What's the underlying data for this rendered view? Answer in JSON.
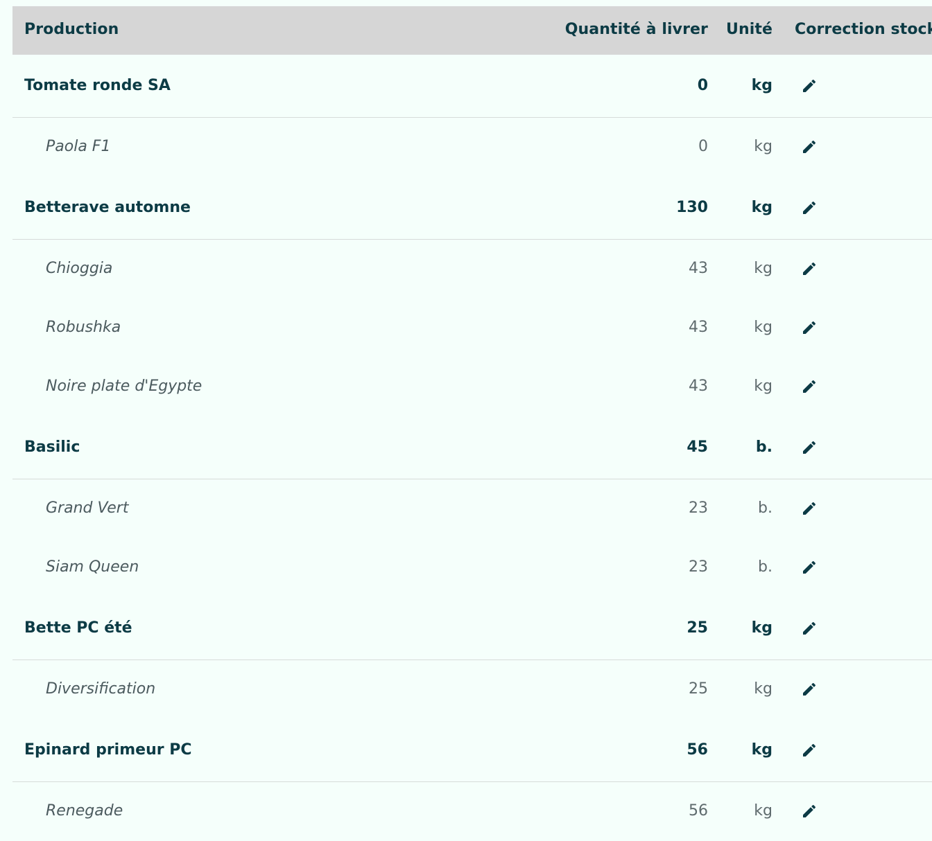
{
  "columns": {
    "production": "Production",
    "quantity": "Quantité à livrer",
    "unit": "Unité",
    "correction": "Correction stock"
  },
  "rows": [
    {
      "type": "group",
      "name": "Tomate ronde SA",
      "quantity": "0",
      "unit": "kg"
    },
    {
      "type": "sub",
      "name": "Paola F1",
      "quantity": "0",
      "unit": "kg"
    },
    {
      "type": "group",
      "name": "Betterave automne",
      "quantity": "130",
      "unit": "kg"
    },
    {
      "type": "sub",
      "name": "Chioggia",
      "quantity": "43",
      "unit": "kg"
    },
    {
      "type": "sub",
      "name": "Robushka",
      "quantity": "43",
      "unit": "kg"
    },
    {
      "type": "sub",
      "name": "Noire plate d'Egypte",
      "quantity": "43",
      "unit": "kg"
    },
    {
      "type": "group",
      "name": "Basilic",
      "quantity": "45",
      "unit": "b."
    },
    {
      "type": "sub",
      "name": "Grand Vert",
      "quantity": "23",
      "unit": "b."
    },
    {
      "type": "sub",
      "name": "Siam Queen",
      "quantity": "23",
      "unit": "b."
    },
    {
      "type": "group",
      "name": "Bette PC été",
      "quantity": "25",
      "unit": "kg"
    },
    {
      "type": "sub",
      "name": "Diversification",
      "quantity": "25",
      "unit": "kg"
    },
    {
      "type": "group",
      "name": "Epinard primeur PC",
      "quantity": "56",
      "unit": "kg"
    },
    {
      "type": "sub",
      "name": "Renegade",
      "quantity": "56",
      "unit": "kg"
    }
  ],
  "icons": {
    "edit": "pencil-icon"
  },
  "colors": {
    "header_bg": "#d6d6d6",
    "page_bg": "#f5fffb",
    "text_primary": "#0c3b45",
    "text_secondary": "#5e6a6d"
  }
}
